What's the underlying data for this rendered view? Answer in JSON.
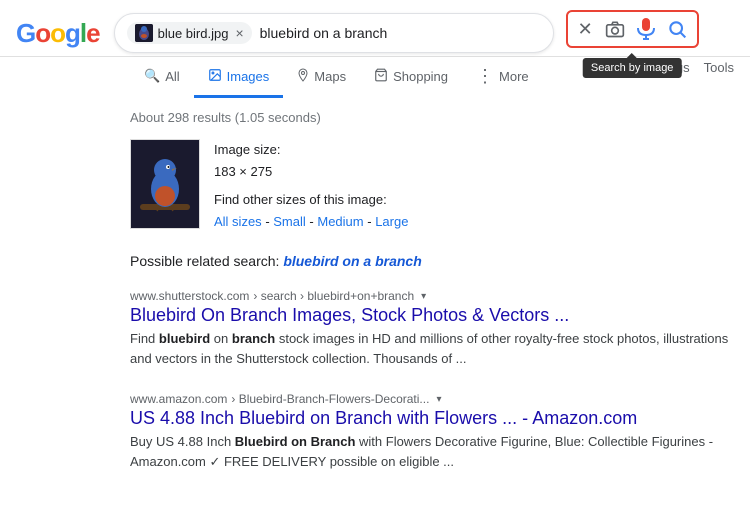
{
  "header": {
    "logo": [
      "G",
      "o",
      "o",
      "g",
      "l",
      "e"
    ],
    "search_pill": {
      "filename": "blue bird.jpg",
      "close": "×"
    },
    "search_query": "bluebird on a branch",
    "icons": {
      "close_label": "×",
      "camera_label": "camera",
      "mic_label": "mic",
      "search_label": "search"
    },
    "tooltip": "Search by image"
  },
  "nav": {
    "tabs": [
      {
        "label": "All",
        "icon": "🔍",
        "active": false
      },
      {
        "label": "Images",
        "icon": "🖼",
        "active": true
      },
      {
        "label": "Maps",
        "icon": "📍",
        "active": false
      },
      {
        "label": "Shopping",
        "icon": "🛍",
        "active": false
      },
      {
        "label": "More",
        "icon": "⋮",
        "active": false
      }
    ],
    "settings": "Settings",
    "tools": "Tools"
  },
  "main": {
    "result_stats": "About 298 results (1.05 seconds)",
    "image_info": {
      "size_label": "Image size:",
      "size_value": "183 × 275",
      "find_label": "Find other sizes of this image:",
      "size_links": [
        "All sizes",
        "Small",
        "Medium",
        "Large"
      ]
    },
    "related_search": {
      "prefix": "Possible related search:",
      "link_text": "bluebird on a branch"
    },
    "results": [
      {
        "url_domain": "www.shutterstock.com",
        "url_path": "› search › bluebird+on+branch",
        "title": "Bluebird On Branch Images, Stock Photos & Vectors ...",
        "snippet": "Find bluebird on branch stock images in HD and millions of other royalty-free stock photos, illustrations and vectors in the Shutterstock collection. Thousands of ..."
      },
      {
        "url_domain": "www.amazon.com",
        "url_path": "› Bluebird-Branch-Flowers-Decorati...",
        "title": "US 4.88 Inch Bluebird on Branch with Flowers ... - Amazon.com",
        "snippet": "Buy US 4.88 Inch Bluebird on Branch with Flowers Decorative Figurine, Blue: Collectible Figurines - Amazon.com ✓ FREE DELIVERY possible on eligible ..."
      }
    ]
  }
}
